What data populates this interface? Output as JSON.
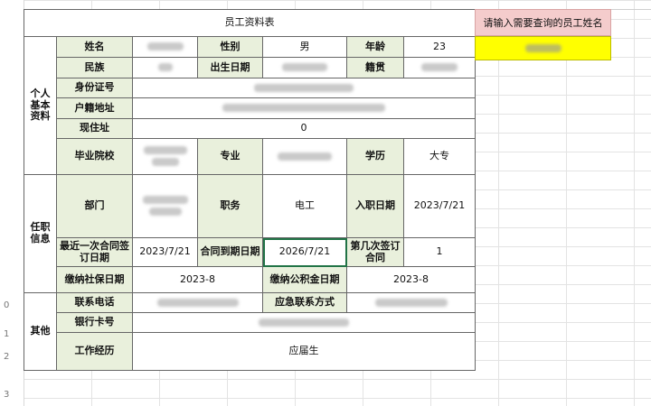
{
  "title": "员工资料表",
  "search": {
    "prompt": "请输入需要查询的员工姓名"
  },
  "row_headers": [
    "0",
    "1",
    "2",
    "3"
  ],
  "sections": {
    "personal": "个人\n基本\n资料",
    "job": "任职\n信息",
    "other": "其他"
  },
  "labels": {
    "name": "姓名",
    "gender": "性别",
    "age": "年龄",
    "ethnicity": "民族",
    "birth": "出生日期",
    "native": "籍贯",
    "id": "身份证号",
    "hukou": "户籍地址",
    "address": "现住址",
    "school": "毕业院校",
    "major": "专业",
    "education": "学历",
    "dept": "部门",
    "position": "职务",
    "hire_date": "入职日期",
    "last_contract": "最近一次合同签订日期",
    "contract_end": "合同到期日期",
    "nth_contract": "第几次签订合同",
    "social": "缴纳社保日期",
    "fund": "缴纳公积金日期",
    "phone": "联系电话",
    "emergency": "应急联系方式",
    "bank": "银行卡号",
    "experience": "工作经历"
  },
  "values": {
    "gender": "男",
    "age": "23",
    "address": "0",
    "education": "大专",
    "position": "电工",
    "hire_date": "2023/7/21",
    "last_contract": "2023/7/21",
    "contract_end": "2026/7/21",
    "nth_contract": "1",
    "social": "2023-8",
    "fund": "2023-8",
    "experience": "应届生"
  }
}
